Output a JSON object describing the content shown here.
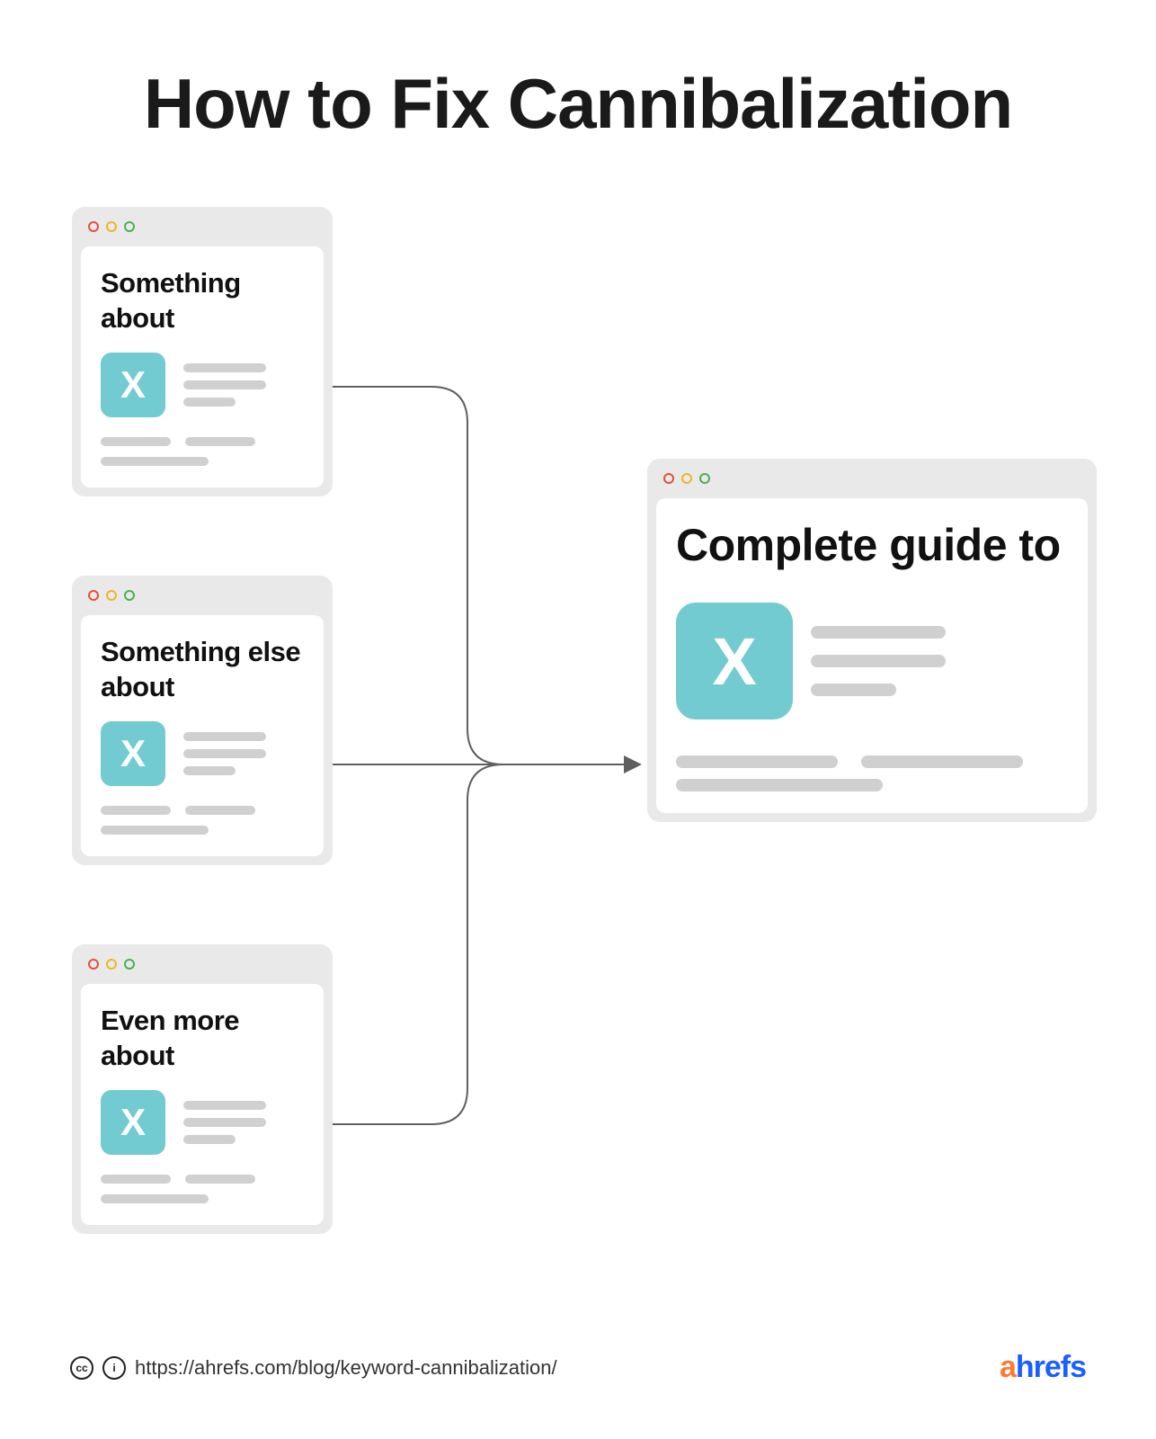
{
  "title": "How to Fix Cannibalization",
  "cards": {
    "c1": {
      "heading": "Something about",
      "topic": "X"
    },
    "c2": {
      "heading": "Something else about",
      "topic": "X"
    },
    "c3": {
      "heading": "Even more about",
      "topic": "X"
    },
    "big": {
      "heading": "Complete guide to",
      "topic": "X"
    }
  },
  "footer": {
    "cc": "cc",
    "by": "i",
    "url": "https://ahrefs.com/blog/keyword-cannibalization/",
    "brand_a": "a",
    "brand_rest": "hrefs"
  },
  "colors": {
    "topic_tile": "#72cbd0",
    "placeholder": "#d0d0d0",
    "card_bg": "#e9e9e9"
  }
}
